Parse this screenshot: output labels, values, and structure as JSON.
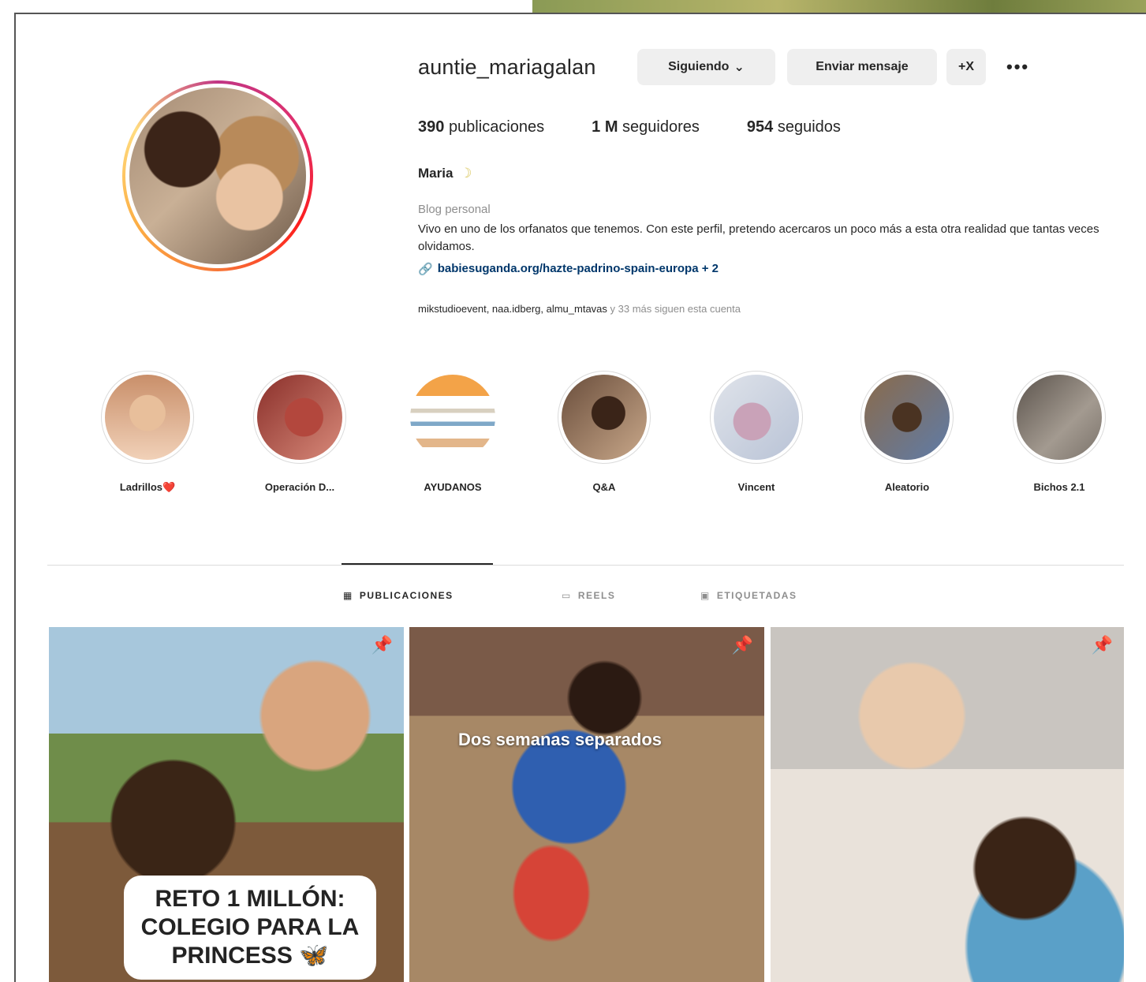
{
  "profile": {
    "username": "auntie_mariagalan",
    "follow_button": "Siguiendo",
    "message_button": "Enviar mensaje",
    "add_icon": "+X",
    "more_icon": "•••",
    "stats": {
      "posts_count": "390",
      "posts_label": "publicaciones",
      "followers_count": "1 M",
      "followers_label": "seguidores",
      "following_count": "954",
      "following_label": "seguidos"
    },
    "display_name": "Maria",
    "display_name_emoji": "☽",
    "category": "Blog personal",
    "bio": "Vivo en uno de los orfanatos que tenemos. Con este perfil, pretendo acercaros un poco más a esta otra realidad que tantas veces olvidamos.",
    "link_icon": "link-icon",
    "link_text": "babiesuganda.org/hazte-padrino-spain-europa + 2",
    "followed_by_names": "mikstudioevent, naa.idberg, almu_mtavas",
    "followed_by_rest": " y 33 más siguen esta cuenta"
  },
  "highlights": [
    {
      "label": "Ladrillos❤️"
    },
    {
      "label": "Operación D..."
    },
    {
      "label": "AYUDANOS"
    },
    {
      "label": "Q&A"
    },
    {
      "label": "Vincent"
    },
    {
      "label": "Aleatorio"
    },
    {
      "label": "Bichos 2.1"
    }
  ],
  "tabs": {
    "posts": "PUBLICACIONES",
    "reels": "REELS",
    "tagged": "ETIQUETADAS"
  },
  "posts": [
    {
      "caption": "RETO 1 MILLÓN: COLEGIO PARA LA PRINCESS",
      "caption_emoji": "🦋"
    },
    {
      "overlay_text": "Dos semanas separados"
    },
    {}
  ]
}
